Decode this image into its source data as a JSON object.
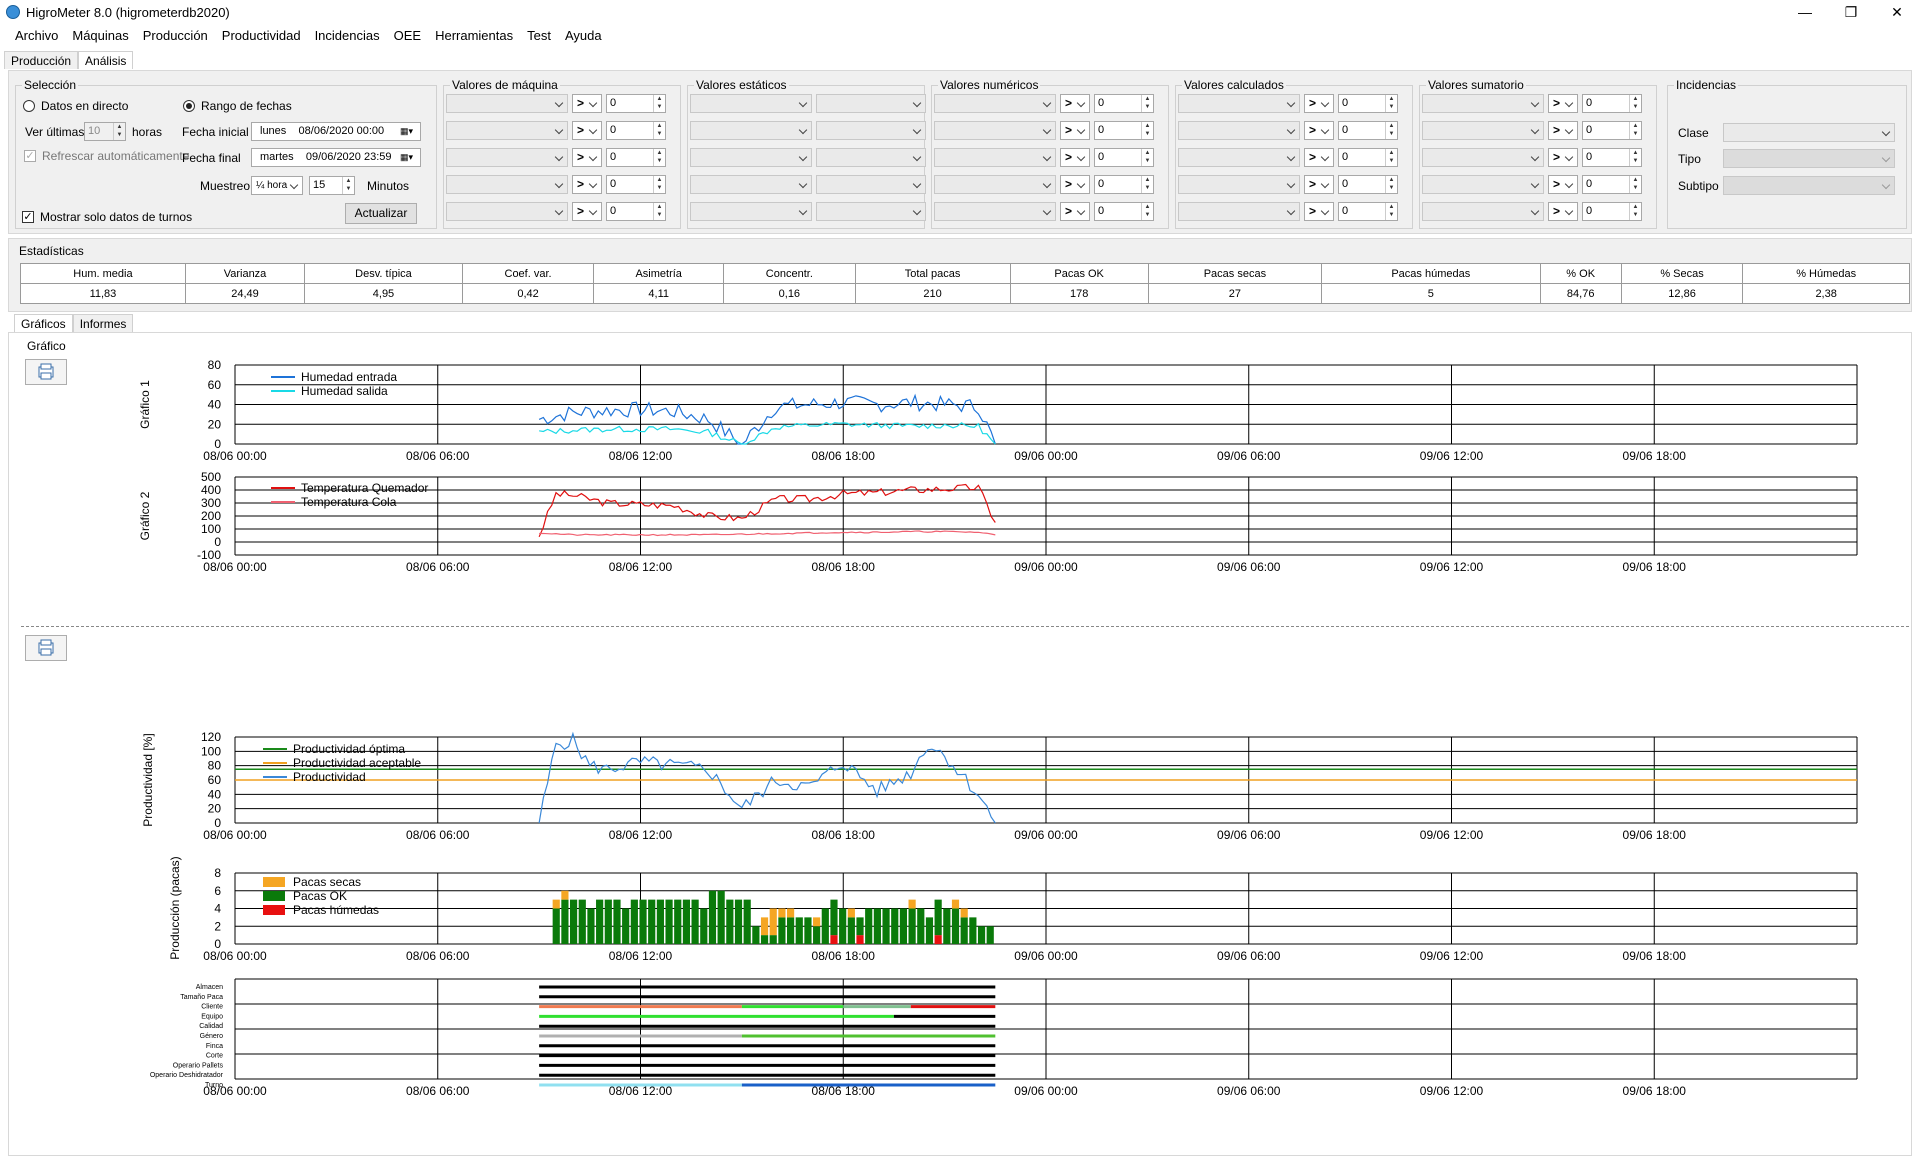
{
  "window": {
    "title": "HigroMeter 8.0 (higrometerdb2020)",
    "min": "—",
    "max": "❐",
    "close": "✕"
  },
  "menu": [
    "Archivo",
    "Máquinas",
    "Producción",
    "Productividad",
    "Incidencias",
    "OEE",
    "Herramientas",
    "Test",
    "Ayuda"
  ],
  "main_tabs": [
    "Producción",
    "Análisis"
  ],
  "seleccion": {
    "title": "Selección",
    "directo": "Datos en directo",
    "rango": "Rango de fechas",
    "ver_ultimas": "Ver últimas",
    "horas_value": "10",
    "horas": "horas",
    "refrescar": "Refrescar automáticamente",
    "fecha_inicial_label": "Fecha inicial",
    "fecha_inicial_day": "lunes",
    "fecha_inicial": "08/06/2020 00:00",
    "fecha_final_label": "Fecha final",
    "fecha_final_day": "martes",
    "fecha_final": "09/06/2020 23:59",
    "muestreo": "Muestreo",
    "muestreo_value": "¼ hora",
    "minutos_value": "15",
    "minutos": "Minutos",
    "actualizar": "Actualizar",
    "solo_turnos": "Mostrar solo datos de turnos"
  },
  "filter_groups": [
    "Valores de máquina",
    "Valores estáticos",
    "Valores numéricos",
    "Valores calculados",
    "Valores sumatorio"
  ],
  "filter_op": ">",
  "filter_value": "0",
  "incidencias": {
    "title": "Incidencias",
    "clase": "Clase",
    "tipo": "Tipo",
    "subtipo": "Subtipo"
  },
  "estadisticas": {
    "title": "Estadísticas",
    "headers": [
      "Hum. media",
      "Varianza",
      "Desv. típica",
      "Coef. var.",
      "Asimetría",
      "Concentr.",
      "Total pacas",
      "Pacas OK",
      "Pacas secas",
      "Pacas húmedas",
      "% OK",
      "% Secas",
      "% Húmedas"
    ],
    "values": [
      "11,83",
      "24,49",
      "4,95",
      "0,42",
      "4,11",
      "0,16",
      "210",
      "178",
      "27",
      "5",
      "84,76",
      "12,86",
      "2,38"
    ]
  },
  "sub_tabs": [
    "Gráficos",
    "Informes"
  ],
  "grafico_group": "Gráfico",
  "x_ticks": [
    "08/06 00:00",
    "08/06 06:00",
    "08/06 12:00",
    "08/06 18:00",
    "09/06 00:00",
    "09/06 06:00",
    "09/06 12:00",
    "09/06 18:00"
  ],
  "chart_data": [
    {
      "type": "line",
      "ylabel": "Gráfico 1",
      "ylim": [
        0,
        80
      ],
      "yticks": [
        "80",
        "60",
        "40",
        "20",
        "0"
      ],
      "series": [
        {
          "name": "Humedad entrada",
          "color": "#1e73d8",
          "x_hours": [
            9,
            10,
            11,
            12,
            13,
            14,
            15,
            16,
            17,
            18,
            19,
            20,
            21,
            22,
            22.5
          ],
          "values": [
            25,
            32,
            34,
            35,
            33,
            25,
            0,
            38,
            40,
            42,
            40,
            42,
            40,
            38,
            0
          ]
        },
        {
          "name": "Humedad salida",
          "color": "#19d9e6",
          "x_hours": [
            9,
            10,
            11,
            12,
            13,
            14,
            15,
            16,
            17,
            18,
            19,
            20,
            21,
            22,
            22.5
          ],
          "values": [
            12,
            14,
            15,
            15,
            15,
            12,
            0,
            17,
            19,
            20,
            19,
            18,
            19,
            18,
            0
          ]
        }
      ]
    },
    {
      "type": "line",
      "ylabel": "Gráfico 2",
      "ylim": [
        -100,
        500
      ],
      "yticks": [
        "500",
        "400",
        "300",
        "200",
        "100",
        "0",
        "-100"
      ],
      "series": [
        {
          "name": "Temperatura Quemador",
          "color": "#e01010",
          "x_hours": [
            9,
            9.5,
            10,
            11,
            12,
            13,
            14,
            15,
            16,
            17,
            18,
            19,
            20,
            21,
            22,
            22.5
          ],
          "values": [
            50,
            370,
            360,
            300,
            290,
            280,
            200,
            180,
            330,
            330,
            370,
            380,
            400,
            410,
            420,
            150
          ]
        },
        {
          "name": "Temperatura Cola",
          "color": "#f06070",
          "x_hours": [
            9,
            10,
            11,
            12,
            13,
            14,
            15,
            16,
            17,
            18,
            19,
            20,
            21,
            22,
            22.5
          ],
          "values": [
            70,
            55,
            55,
            55,
            55,
            55,
            60,
            65,
            70,
            75,
            75,
            80,
            80,
            75,
            55
          ]
        }
      ]
    },
    {
      "type": "line",
      "ylabel": "Productividad [%]",
      "ylim": [
        0,
        120
      ],
      "yticks": [
        "120",
        "100",
        "80",
        "60",
        "40",
        "20",
        "0"
      ],
      "series": [
        {
          "name": "Productividad óptima",
          "color": "#1a8a1a",
          "constant": 75
        },
        {
          "name": "Productividad aceptable",
          "color": "#f0a020",
          "constant": 60
        },
        {
          "name": "Productividad",
          "color": "#3a88d8",
          "x_hours": [
            9,
            9.5,
            10,
            10.5,
            11,
            12,
            13,
            14,
            15,
            16,
            17,
            18,
            19,
            20,
            20.5,
            21,
            22,
            22.5
          ],
          "values": [
            0,
            110,
            115,
            80,
            75,
            85,
            80,
            75,
            20,
            60,
            50,
            85,
            45,
            70,
            110,
            95,
            40,
            0
          ]
        }
      ]
    },
    {
      "type": "bar",
      "ylabel": "Producción (pacas)",
      "ylim": [
        0,
        8
      ],
      "yticks": [
        "8",
        "6",
        "4",
        "2",
        "0"
      ],
      "series": [
        {
          "name": "Pacas secas",
          "color": "#f5a623"
        },
        {
          "name": "Pacas OK",
          "color": "#0a7a0a"
        },
        {
          "name": "Pacas húmedas",
          "color": "#e81010"
        }
      ],
      "ok": [
        4,
        5,
        5,
        5,
        4,
        5,
        5,
        5,
        4,
        5,
        5,
        5,
        5,
        5,
        5,
        5,
        5,
        4,
        6,
        6,
        5,
        5,
        5,
        2,
        1,
        1,
        3,
        3,
        3,
        3,
        2,
        4,
        4,
        4,
        3,
        2,
        4,
        4,
        4,
        4,
        4,
        4,
        4,
        3,
        4,
        4,
        4,
        3,
        3,
        2,
        2
      ],
      "secas": [
        1,
        1,
        0,
        0,
        0,
        0,
        0,
        0,
        0,
        0,
        0,
        0,
        0,
        0,
        0,
        0,
        0,
        0,
        0,
        0,
        0,
        0,
        0,
        0,
        2,
        3,
        1,
        1,
        0,
        0,
        1,
        0,
        0,
        0,
        1,
        0,
        0,
        0,
        0,
        0,
        0,
        1,
        0,
        0,
        0,
        0,
        1,
        1,
        0,
        0,
        0
      ],
      "humedas": [
        0,
        0,
        0,
        0,
        0,
        0,
        0,
        0,
        0,
        0,
        0,
        0,
        0,
        0,
        0,
        0,
        0,
        0,
        0,
        0,
        0,
        0,
        0,
        0,
        0,
        0,
        0,
        0,
        0,
        0,
        0,
        0,
        1,
        0,
        0,
        1,
        0,
        0,
        0,
        0,
        0,
        0,
        0,
        0,
        1,
        0,
        0,
        0,
        0,
        0,
        0
      ]
    },
    {
      "type": "timeline",
      "categories": [
        "Almacen",
        "Tamaño Paca",
        "Cliente",
        "Equipo",
        "Calidad",
        "Género",
        "Finca",
        "Corte",
        "Operario Pallets",
        "Operario Deshidratador",
        "Turno"
      ],
      "segments": [
        [
          {
            "from": 9,
            "to": 22.5,
            "color": "#000000"
          }
        ],
        [
          {
            "from": 9,
            "to": 22.5,
            "color": "#000000"
          }
        ],
        [
          {
            "from": 9,
            "to": 15,
            "color": "#f07a50"
          },
          {
            "from": 15,
            "to": 18,
            "color": "#30e030"
          },
          {
            "from": 18,
            "to": 20,
            "color": "#80c090"
          },
          {
            "from": 20,
            "to": 22.5,
            "color": "#e01010"
          }
        ],
        [
          {
            "from": 9,
            "to": 19.5,
            "color": "#30e030"
          },
          {
            "from": 19.5,
            "to": 22.5,
            "color": "#000000"
          }
        ],
        [
          {
            "from": 9,
            "to": 22.5,
            "color": "#000000"
          }
        ],
        [
          {
            "from": 9,
            "to": 15,
            "color": "#b0b0b0"
          },
          {
            "from": 15,
            "to": 22.5,
            "color": "#50c030"
          }
        ],
        [
          {
            "from": 9,
            "to": 22.5,
            "color": "#000000"
          }
        ],
        [
          {
            "from": 9,
            "to": 22.5,
            "color": "#000000"
          }
        ],
        [
          {
            "from": 9,
            "to": 22.5,
            "color": "#000000"
          }
        ],
        [
          {
            "from": 9,
            "to": 22.5,
            "color": "#000000"
          }
        ],
        [
          {
            "from": 9,
            "to": 15,
            "color": "#90e0f0"
          },
          {
            "from": 15,
            "to": 22.5,
            "color": "#1a60c8"
          }
        ]
      ]
    }
  ]
}
